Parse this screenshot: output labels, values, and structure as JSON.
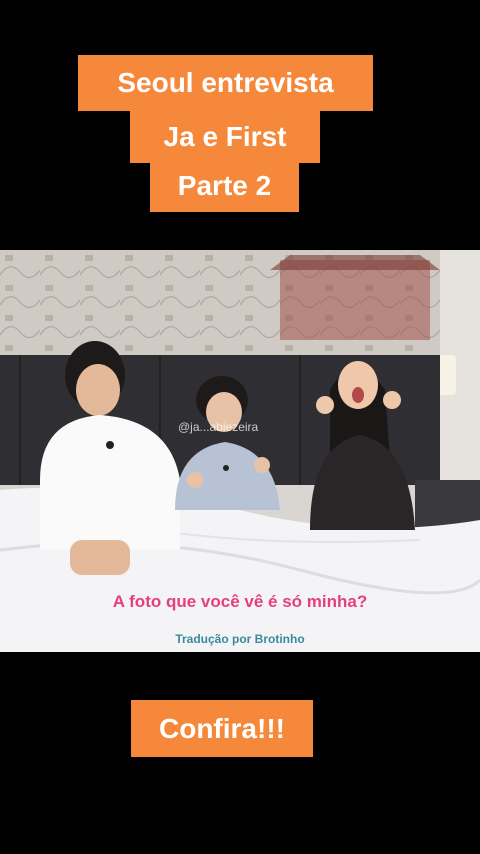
{
  "title": {
    "line1": "Seoul entrevista",
    "line2": "Ja e First",
    "line3": "Parte 2"
  },
  "video": {
    "watermark": "@ja...abiezeira",
    "subtitle": "A foto que você vê é só minha?",
    "credit": "Tradução por Brotinho"
  },
  "cta": {
    "label": "Confira!!!"
  },
  "colors": {
    "accent": "#f5883a",
    "subtitle": "#e5407a",
    "credit": "#3a8a9a",
    "background": "#000000"
  }
}
